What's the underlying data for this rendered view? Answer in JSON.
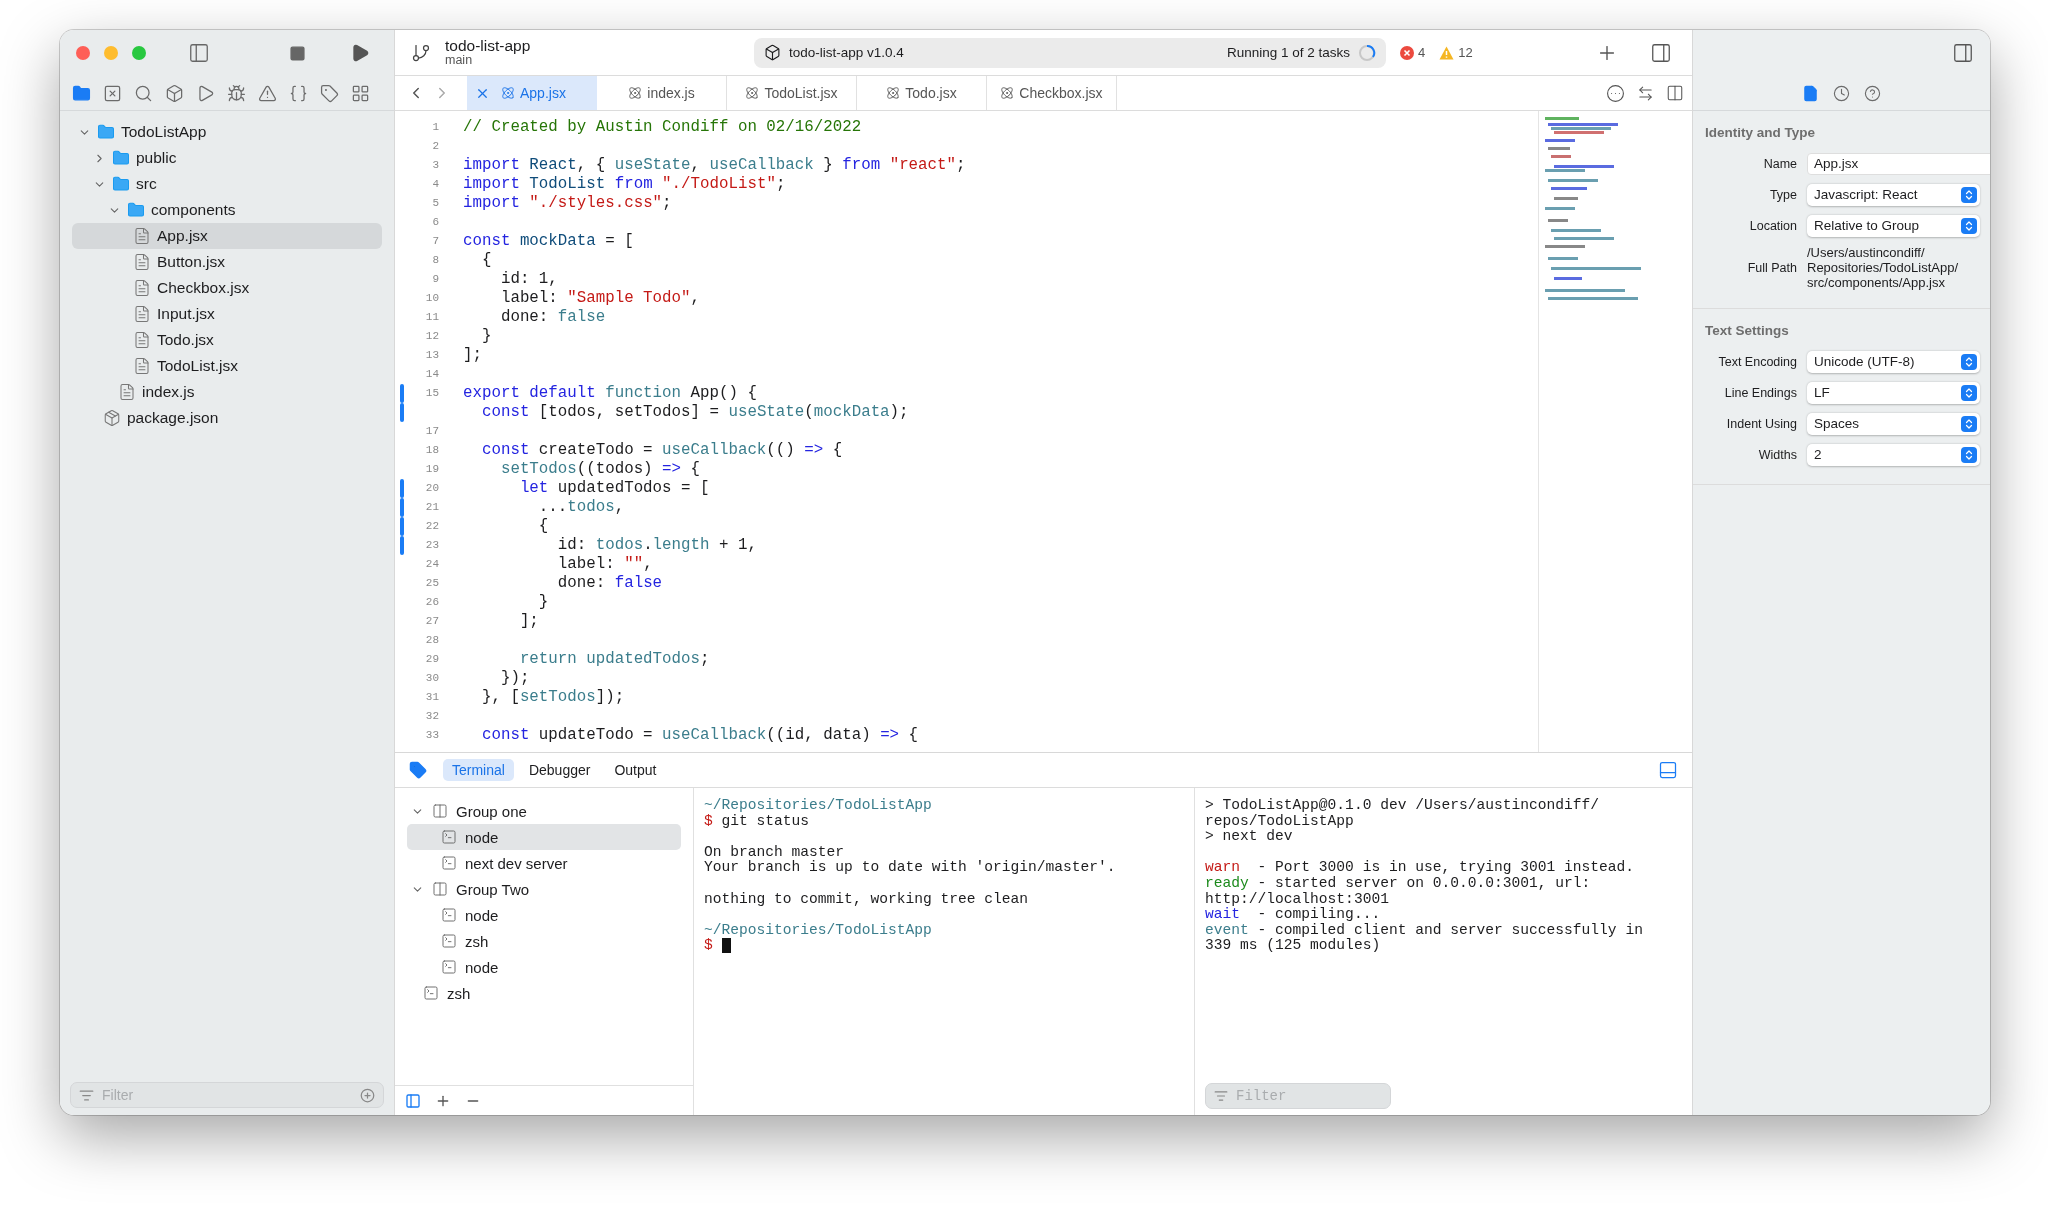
{
  "toolbar": {
    "project": "todo-list-app",
    "branch": "main",
    "scheme": "todo-list-app v1.0.4",
    "status": "Running 1 of 2 tasks",
    "errors": "4",
    "warnings": "12"
  },
  "navigator": {
    "tabs": [
      {
        "selected": true
      },
      {
        "selected": false
      },
      {
        "selected": false
      },
      {
        "selected": false
      },
      {
        "selected": false
      },
      {
        "selected": false
      },
      {
        "selected": false
      },
      {
        "selected": false
      },
      {
        "selected": false
      },
      {
        "selected": false
      }
    ],
    "tree": [
      {
        "name": "TodoListApp",
        "kind": "folder",
        "expanded": true,
        "selected": false,
        "children": [
          {
            "name": "public",
            "kind": "folder",
            "expanded": false,
            "selected": false
          },
          {
            "name": "src",
            "kind": "folder",
            "expanded": true,
            "selected": false,
            "children": [
              {
                "name": "components",
                "kind": "folder",
                "expanded": true,
                "selected": false,
                "children": [
                  {
                    "name": "App.jsx",
                    "kind": "file",
                    "selected": true
                  },
                  {
                    "name": "Button.jsx",
                    "kind": "file",
                    "selected": false
                  },
                  {
                    "name": "Checkbox.jsx",
                    "kind": "file",
                    "selected": false
                  },
                  {
                    "name": "Input.jsx",
                    "kind": "file",
                    "selected": false
                  },
                  {
                    "name": "Todo.jsx",
                    "kind": "file",
                    "selected": false
                  },
                  {
                    "name": "TodoList.jsx",
                    "kind": "file",
                    "selected": false
                  }
                ]
              },
              {
                "name": "index.js",
                "kind": "file",
                "selected": false
              }
            ]
          },
          {
            "name": "package.json",
            "kind": "package",
            "selected": false
          }
        ]
      }
    ],
    "filter": {
      "placeholder": "Filter"
    }
  },
  "editor": {
    "tabs": [
      {
        "label": "App.jsx",
        "selected": true
      },
      {
        "label": "index.js",
        "selected": false
      },
      {
        "label": "TodoList.jsx",
        "selected": false
      },
      {
        "label": "Todo.jsx",
        "selected": false
      },
      {
        "label": "Checkbox.jsx",
        "selected": false
      }
    ],
    "lines": [
      {
        "number": "1",
        "changed": false,
        "tokens": [
          {
            "text": "// Created by Austin Condiff on 02/16/2022",
            "kind": "comment"
          }
        ]
      },
      {
        "number": "2",
        "changed": false
      },
      {
        "number": "3",
        "changed": false,
        "tokens": [
          {
            "text": "import",
            "kind": "keyword"
          },
          {
            "text": " React",
            "kind": "decl"
          },
          {
            "text": ", { ",
            "kind": "plain"
          },
          {
            "text": "useState",
            "kind": "ident"
          },
          {
            "text": ", ",
            "kind": "plain"
          },
          {
            "text": "useCallback",
            "kind": "ident"
          },
          {
            "text": " } ",
            "kind": "plain"
          },
          {
            "text": "from",
            "kind": "keyword"
          },
          {
            "text": " \"react\"",
            "kind": "string"
          },
          {
            "text": ";",
            "kind": "plain"
          }
        ]
      },
      {
        "number": "4",
        "changed": false,
        "tokens": [
          {
            "text": "import",
            "kind": "keyword"
          },
          {
            "text": " TodoList",
            "kind": "decl"
          },
          {
            "text": " from",
            "kind": "keyword"
          },
          {
            "text": " \"./TodoList\"",
            "kind": "string"
          },
          {
            "text": ";",
            "kind": "plain"
          }
        ]
      },
      {
        "number": "5",
        "changed": false,
        "tokens": [
          {
            "text": "import",
            "kind": "keyword"
          },
          {
            "text": " \"./styles.css\"",
            "kind": "string"
          },
          {
            "text": ";",
            "kind": "plain"
          }
        ]
      },
      {
        "number": "6",
        "changed": false
      },
      {
        "number": "7",
        "changed": false,
        "tokens": [
          {
            "text": "const",
            "kind": "keyword"
          },
          {
            "text": " mockData",
            "kind": "decl"
          },
          {
            "text": " = [",
            "kind": "plain"
          }
        ]
      },
      {
        "number": "8",
        "changed": false,
        "tokens": [
          {
            "text": "  {",
            "kind": "plain"
          }
        ]
      },
      {
        "number": "9",
        "changed": false,
        "tokens": [
          {
            "text": "    id: 1,",
            "kind": "plain"
          }
        ]
      },
      {
        "number": "10",
        "changed": false,
        "tokens": [
          {
            "text": "    label: ",
            "kind": "plain"
          },
          {
            "text": "\"Sample Todo\"",
            "kind": "string"
          },
          {
            "text": ",",
            "kind": "plain"
          }
        ]
      },
      {
        "number": "11",
        "changed": false,
        "tokens": [
          {
            "text": "    done: ",
            "kind": "plain"
          },
          {
            "text": "false",
            "kind": "ident"
          }
        ]
      },
      {
        "number": "12",
        "changed": false,
        "tokens": [
          {
            "text": "  }",
            "kind": "plain"
          }
        ]
      },
      {
        "number": "13",
        "changed": false,
        "tokens": [
          {
            "text": "];",
            "kind": "plain"
          }
        ]
      },
      {
        "number": "14",
        "changed": false
      },
      {
        "number": "15",
        "changed": true,
        "tokens": [
          {
            "text": "export default",
            "kind": "keyword"
          },
          {
            "text": " function",
            "kind": "ident"
          },
          {
            "text": " App() {",
            "kind": "plain"
          }
        ]
      },
      {
        "changed": true,
        "tokens": [
          {
            "text": "  const",
            "kind": "keyword"
          },
          {
            "text": " [todos, setTodos] = ",
            "kind": "plain"
          },
          {
            "text": "useState",
            "kind": "ident"
          },
          {
            "text": "(",
            "kind": "plain"
          },
          {
            "text": "mockData",
            "kind": "ident"
          },
          {
            "text": ");",
            "kind": "plain"
          }
        ]
      },
      {
        "number": "17",
        "changed": false
      },
      {
        "number": "18",
        "changed": false,
        "tokens": [
          {
            "text": "  const",
            "kind": "keyword"
          },
          {
            "text": " createTodo = ",
            "kind": "plain"
          },
          {
            "text": "useCallback",
            "kind": "ident"
          },
          {
            "text": "(() ",
            "kind": "plain"
          },
          {
            "text": "=>",
            "kind": "keyword"
          },
          {
            "text": " {",
            "kind": "plain"
          }
        ]
      },
      {
        "number": "19",
        "changed": false,
        "tokens": [
          {
            "text": "    setTodos",
            "kind": "ident"
          },
          {
            "text": "((todos) ",
            "kind": "plain"
          },
          {
            "text": "=>",
            "kind": "keyword"
          },
          {
            "text": " {",
            "kind": "plain"
          }
        ]
      },
      {
        "number": "20",
        "changed": true,
        "tokens": [
          {
            "text": "      let",
            "kind": "keyword"
          },
          {
            "text": " updatedTodos = [",
            "kind": "plain"
          }
        ]
      },
      {
        "number": "21",
        "changed": true,
        "tokens": [
          {
            "text": "        ...",
            "kind": "plain"
          },
          {
            "text": "todos",
            "kind": "ident"
          },
          {
            "text": ",",
            "kind": "plain"
          }
        ]
      },
      {
        "number": "22",
        "changed": true,
        "tokens": [
          {
            "text": "        {",
            "kind": "plain"
          }
        ]
      },
      {
        "number": "23",
        "changed": true,
        "tokens": [
          {
            "text": "          id: ",
            "kind": "plain"
          },
          {
            "text": "todos",
            "kind": "ident"
          },
          {
            "text": ".",
            "kind": "plain"
          },
          {
            "text": "length",
            "kind": "ident"
          },
          {
            "text": " + 1,",
            "kind": "plain"
          }
        ]
      },
      {
        "number": "24",
        "changed": false,
        "tokens": [
          {
            "text": "          label: ",
            "kind": "plain"
          },
          {
            "text": "\"\"",
            "kind": "string"
          },
          {
            "text": ",",
            "kind": "plain"
          }
        ]
      },
      {
        "number": "25",
        "changed": false,
        "tokens": [
          {
            "text": "          done: ",
            "kind": "plain"
          },
          {
            "text": "false",
            "kind": "keyword"
          }
        ]
      },
      {
        "number": "26",
        "changed": false,
        "tokens": [
          {
            "text": "        }",
            "kind": "plain"
          }
        ]
      },
      {
        "number": "27",
        "changed": false,
        "tokens": [
          {
            "text": "      ];",
            "kind": "plain"
          }
        ]
      },
      {
        "number": "28",
        "changed": false
      },
      {
        "number": "29",
        "changed": false,
        "tokens": [
          {
            "text": "      return updatedTodos",
            "kind": "ident"
          },
          {
            "text": ";",
            "kind": "plain"
          }
        ]
      },
      {
        "number": "30",
        "changed": false,
        "tokens": [
          {
            "text": "    });",
            "kind": "plain"
          }
        ]
      },
      {
        "number": "31",
        "changed": false,
        "tokens": [
          {
            "text": "  }, [",
            "kind": "plain"
          },
          {
            "text": "setTodos",
            "kind": "ident"
          },
          {
            "text": "]);",
            "kind": "plain"
          }
        ]
      },
      {
        "number": "32",
        "changed": false
      },
      {
        "number": "33",
        "changed": false,
        "tokens": [
          {
            "text": "  const",
            "kind": "keyword"
          },
          {
            "text": " updateTodo = ",
            "kind": "plain"
          },
          {
            "text": "useCallback",
            "kind": "ident"
          },
          {
            "text": "((id, data) ",
            "kind": "plain"
          },
          {
            "text": "=>",
            "kind": "keyword"
          },
          {
            "text": " {",
            "kind": "plain"
          }
        ]
      }
    ]
  },
  "bottom_panel": {
    "tabs": [
      {
        "label": "Terminal",
        "selected": true
      },
      {
        "label": "Debugger",
        "selected": false
      },
      {
        "label": "Output",
        "selected": false
      }
    ],
    "sessions": [
      {
        "name": "Group one",
        "kind": "group",
        "expanded": true,
        "selected": false,
        "children": [
          {
            "name": "node",
            "kind": "terminal",
            "selected": true
          },
          {
            "name": "next dev server",
            "kind": "terminal",
            "selected": false
          }
        ]
      },
      {
        "name": "Group Two",
        "kind": "group",
        "expanded": true,
        "selected": false,
        "children": [
          {
            "name": "node",
            "kind": "terminal",
            "selected": false
          },
          {
            "name": "zsh",
            "kind": "terminal",
            "selected": false
          },
          {
            "name": "node",
            "kind": "terminal",
            "selected": false
          }
        ]
      },
      {
        "name": "zsh",
        "kind": "terminal",
        "selected": false
      }
    ],
    "terminals": [
      {
        "lines": [
          {
            "tokens": [
              {
                "text": "~/Repositories/TodoListApp",
                "kind": "path"
              }
            ]
          },
          {
            "tokens": [
              {
                "text": "$",
                "kind": "prompt"
              },
              {
                "text": " git status",
                "kind": "text"
              }
            ]
          },
          {
            "tokens": [
              {
                "text": "On branch master",
                "kind": "text"
              }
            ],
            "space_before": true
          },
          {
            "tokens": [
              {
                "text": "Your branch is up to date with 'origin/master'.",
                "kind": "text"
              }
            ]
          },
          {
            "tokens": [
              {
                "text": "nothing to commit, working tree clean",
                "kind": "text"
              }
            ],
            "space_before": true
          },
          {
            "tokens": [
              {
                "text": "~/Repositories/TodoListApp",
                "kind": "path"
              }
            ],
            "space_before": true
          },
          {
            "tokens": [
              {
                "text": "$",
                "kind": "prompt"
              }
            ],
            "cursor": true
          }
        ]
      },
      {
        "lines": [
          {
            "tokens": [
              {
                "text": "> TodoListApp@0.1.0 dev /Users/austincondiff/",
                "kind": "text"
              }
            ]
          },
          {
            "tokens": [
              {
                "text": "repos/TodoListApp",
                "kind": "text"
              }
            ]
          },
          {
            "tokens": [
              {
                "text": "> next dev",
                "kind": "text"
              }
            ]
          },
          {
            "tokens": [
              {
                "text": "warn",
                "kind": "warn"
              },
              {
                "text": "  - Port 3000 is in use, trying 3001 instead.",
                "kind": "text"
              }
            ],
            "space_before": true
          },
          {
            "tokens": [
              {
                "text": "ready",
                "kind": "ready"
              },
              {
                "text": " - started server on 0.0.0.0:3001, url:",
                "kind": "text"
              }
            ]
          },
          {
            "tokens": [
              {
                "text": "http://localhost:3001",
                "kind": "text"
              }
            ]
          },
          {
            "tokens": [
              {
                "text": "wait",
                "kind": "wait"
              },
              {
                "text": "  - compiling...",
                "kind": "text"
              }
            ]
          },
          {
            "tokens": [
              {
                "text": "event",
                "kind": "event"
              },
              {
                "text": " - compiled client and server successfully in",
                "kind": "text"
              }
            ]
          },
          {
            "tokens": [
              {
                "text": "339 ms (125 modules)",
                "kind": "text"
              }
            ]
          }
        ],
        "filter": {
          "placeholder": "Filter"
        }
      }
    ]
  },
  "inspector": {
    "tabs": [
      {
        "selected": true
      },
      {
        "selected": false
      },
      {
        "selected": false
      }
    ],
    "sections": [
      {
        "title": "Identity and Type",
        "fields": [
          {
            "label": "Name",
            "kind": "text",
            "value": "App.jsx"
          },
          {
            "label": "Type",
            "kind": "select",
            "value": "Javascript: React"
          },
          {
            "label": "Location",
            "kind": "select",
            "value": "Relative to Group"
          },
          {
            "label": "Full Path",
            "kind": "path",
            "value": "/Users/austincondiff/\nRepositories/TodoListApp/\nsrc/components/App.jsx"
          }
        ]
      },
      {
        "title": "Text Settings",
        "fields": [
          {
            "label": "Text Encoding",
            "kind": "select",
            "value": "Unicode (UTF-8)"
          },
          {
            "label": "Line Endings",
            "kind": "select",
            "value": "LF"
          },
          {
            "label": "Indent Using",
            "kind": "select",
            "value": "Spaces"
          },
          {
            "label": "Widths",
            "kind": "select",
            "value": "2"
          }
        ]
      }
    ]
  }
}
